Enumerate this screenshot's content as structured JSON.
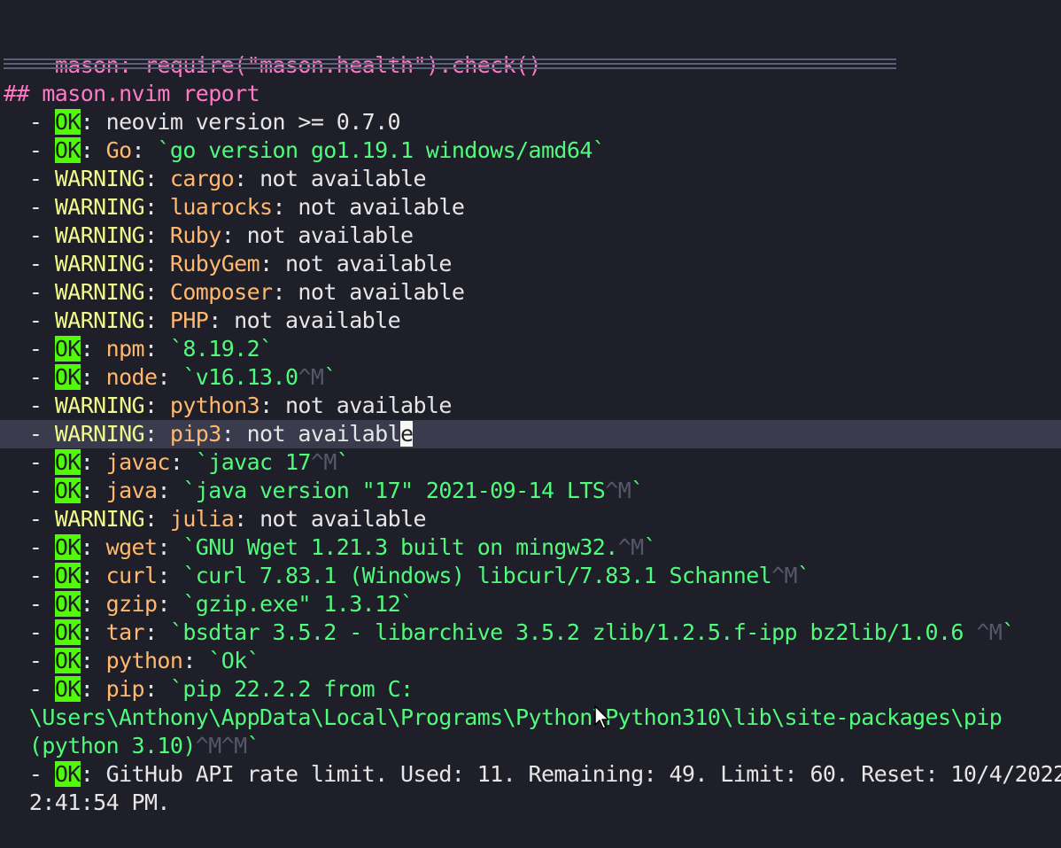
{
  "header": {
    "command": "mason: require(\"mason.health\").check()",
    "section_prefix": "## ",
    "section_title": "mason.nvim report"
  },
  "labels": {
    "ok": "OK",
    "warning": "WARNING",
    "bullet": "  - ",
    "colon": ": ",
    "backtick": "`",
    "not_available": "not available",
    "caret_m": "^M",
    "caret_m_m": "^M^M"
  },
  "rows": {
    "r0": {
      "text": "neovim version >= 0.7.0"
    },
    "r1": {
      "tool": "Go",
      "code": "go version go1.19.1 windows/amd64"
    },
    "r2": {
      "tool": "cargo"
    },
    "r3": {
      "tool": "luarocks"
    },
    "r4": {
      "tool": "Ruby"
    },
    "r5": {
      "tool": "RubyGem"
    },
    "r6": {
      "tool": "Composer"
    },
    "r7": {
      "tool": "PHP"
    },
    "r8": {
      "tool": "npm",
      "code": "8.19.2"
    },
    "r9": {
      "tool": "node",
      "code": "v16.13.0"
    },
    "r10": {
      "tool": "python3"
    },
    "r11": {
      "tool": "pip3",
      "value_a": "not availabl",
      "value_cursor": "e"
    },
    "r12": {
      "tool": "javac",
      "code": "javac 17"
    },
    "r13": {
      "tool": "java",
      "code": "java version \"17\" 2021-09-14 LTS"
    },
    "r14": {
      "tool": "julia"
    },
    "r15": {
      "tool": "wget",
      "code": "GNU Wget 1.21.3 built on mingw32."
    },
    "r16": {
      "tool": "curl",
      "code": "curl 7.83.1 (Windows) libcurl/7.83.1 Schannel"
    },
    "r17": {
      "tool": "gzip",
      "code": "gzip.exe\" 1.3.12"
    },
    "r18": {
      "tool": "tar",
      "code": "bsdtar 3.5.2 - libarchive 3.5.2 zlib/1.2.5.f-ipp bz2lib/1.0.6 "
    },
    "r19": {
      "tool": "python",
      "code": "Ok"
    },
    "r20": {
      "tool": "pip",
      "code_1": "pip 22.2.2 from C:",
      "code_2": "  \\Users\\Anthony\\AppData\\Local\\Programs\\Python\\Python310\\lib\\site-packages\\pip",
      "code_3": "  (python 3.10)"
    },
    "r21": {
      "text_1": "GitHub API rate limit. Used: 11. Remaining: 49. Limit: 60. Reset: 10/4/2022",
      "text_2": "  2:41:54 PM."
    }
  }
}
